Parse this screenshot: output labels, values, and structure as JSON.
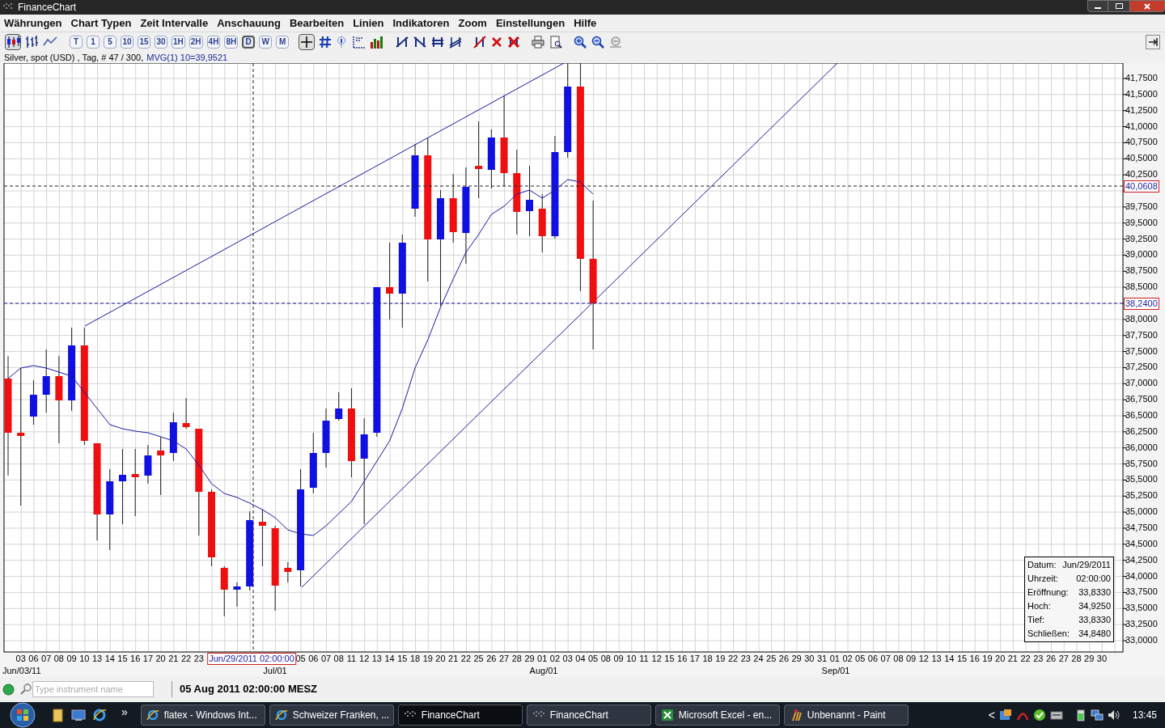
{
  "window": {
    "title": "FinanceChart"
  },
  "menu": [
    "Währungen",
    "Chart Typen",
    "Zeit Intervalle",
    "Anschauung",
    "Bearbeiten",
    "Linien",
    "Indikatoren",
    "Zoom",
    "Einstellungen",
    "Hilfe"
  ],
  "toolbar": {
    "chart_types": [
      {
        "kind": "candle",
        "selected": true
      },
      {
        "kind": "bar",
        "selected": false
      },
      {
        "kind": "line",
        "selected": false
      }
    ],
    "timeframes": [
      {
        "label": "T",
        "selected": false
      },
      {
        "label": "1",
        "selected": false
      },
      {
        "label": "5",
        "selected": false
      },
      {
        "label": "10",
        "selected": false
      },
      {
        "label": "15",
        "selected": false
      },
      {
        "label": "30",
        "selected": false
      },
      {
        "label": "1H",
        "selected": false
      },
      {
        "label": "2H",
        "selected": false
      },
      {
        "label": "4H",
        "selected": false
      },
      {
        "label": "8H",
        "selected": false
      },
      {
        "label": "D",
        "selected": true
      },
      {
        "label": "W",
        "selected": false
      },
      {
        "label": "M",
        "selected": false
      }
    ],
    "crosshair_on": true
  },
  "chart": {
    "instrument_info": "Silver, spot (USD) , Tag, # 47 / 300,",
    "indicator_info": "MVG(1) 10=39,9521",
    "y_axis_labels": [
      "41,7500",
      "41,5000",
      "41,2500",
      "41,0000",
      "40,7500",
      "40,5000",
      "40,2500",
      "39,7500",
      "39,5000",
      "39,2500",
      "39,0000",
      "38,7500",
      "38,5000",
      "38,0000",
      "37,7500",
      "37,5000",
      "37,2500",
      "37,0000",
      "36,7500",
      "36,5000",
      "36,2500",
      "36,0000",
      "35,7500",
      "35,5000",
      "35,2500",
      "35,0000",
      "34,7500",
      "34,5000",
      "34,2500",
      "34,0000",
      "33,7500",
      "33,5000",
      "33,2500",
      "33,0000"
    ],
    "price_markers": [
      {
        "label": "40,0608",
        "kind": "crosshair"
      },
      {
        "label": "38,2400",
        "kind": "last_price"
      }
    ],
    "cursor_date_label": "Jun/29/2011 02:00:00",
    "x_axis_day_labels": [
      "03",
      "06",
      "07",
      "08",
      "09",
      "10",
      "13",
      "14",
      "15",
      "16",
      "17",
      "20",
      "21",
      "22",
      "23",
      "05",
      "06",
      "07",
      "08",
      "11",
      "12",
      "13",
      "14",
      "15",
      "18",
      "19",
      "20",
      "21",
      "22",
      "25",
      "26",
      "27",
      "28",
      "29",
      "01",
      "02",
      "03",
      "04",
      "05",
      "08",
      "09",
      "10",
      "11",
      "12",
      "15",
      "16",
      "17",
      "18",
      "19",
      "22",
      "23",
      "24",
      "25",
      "26",
      "29",
      "30",
      "31",
      "01",
      "02",
      "05",
      "06",
      "07",
      "08",
      "09",
      "12",
      "13",
      "14",
      "15",
      "16",
      "19",
      "20",
      "21",
      "22",
      "23",
      "26",
      "27",
      "28",
      "29",
      "30"
    ],
    "month_labels": [
      "Jun/03/11",
      "Jul/01",
      "Aug/01",
      "Sep/01"
    ],
    "data_window": [
      {
        "label": "Datum:",
        "value": "Jun/29/2011"
      },
      {
        "label": "Uhrzeit:",
        "value": "02:00:00"
      },
      {
        "label": "Eröffnung:",
        "value": "33,8330"
      },
      {
        "label": "Hoch:",
        "value": "34,9250"
      },
      {
        "label": "Tief:",
        "value": "33,8330"
      },
      {
        "label": "Schließen:",
        "value": "34,8480"
      }
    ]
  },
  "status_bar": {
    "search_placeholder": "Type instrument name",
    "datetime": "05 Aug 2011 02:00:00 MESZ"
  },
  "taskbar": {
    "overflow": "»",
    "buttons": [
      {
        "label": "flatex - Windows Int...",
        "kind": "browser",
        "selected": false
      },
      {
        "label": "Schweizer Franken, ...",
        "kind": "browser",
        "selected": false
      },
      {
        "label": "FinanceChart",
        "kind": "app",
        "selected": true
      },
      {
        "label": "FinanceChart",
        "kind": "app",
        "selected": false
      },
      {
        "label": "Microsoft Excel - en...",
        "kind": "spreadsheet",
        "selected": false
      },
      {
        "label": "Unbenannt - Paint",
        "kind": "paint",
        "selected": false
      }
    ],
    "tray_arrow": "<",
    "clock": "13:45"
  }
}
